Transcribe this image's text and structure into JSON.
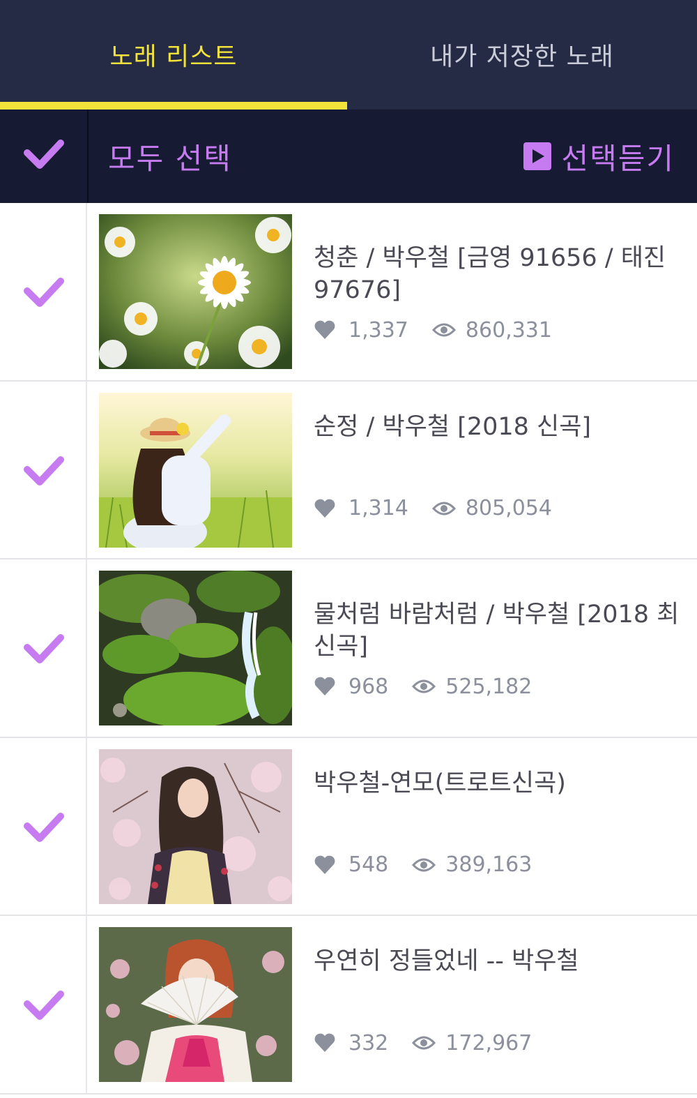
{
  "tabs": [
    {
      "label": "노래 리스트",
      "active": true
    },
    {
      "label": "내가 저장한 노래",
      "active": false
    }
  ],
  "select_bar": {
    "select_all_label": "모두 선택",
    "play_selected_label": "선택듣기"
  },
  "colors": {
    "accent_purple": "#c77bf0",
    "tab_active_yellow": "#f2e23a",
    "header_bg": "#252b45",
    "select_bar_bg": "#161a33"
  },
  "songs": [
    {
      "title": "청춘 / 박우철 [금영 91656 / 태진 97676]",
      "likes": "1,337",
      "views": "860,331",
      "thumbnail": "daisy-flowers",
      "checked": true
    },
    {
      "title": "순정 / 박우철 [2018 신곡]",
      "likes": "1,314",
      "views": "805,054",
      "thumbnail": "woman-in-meadow",
      "checked": true
    },
    {
      "title": "물처럼 바람처럼  / 박우철 [2018 최신곡]",
      "likes": "968",
      "views": "525,182",
      "thumbnail": "mossy-waterfall",
      "checked": true
    },
    {
      "title": "박우철-연모(트로트신곡)",
      "likes": "548",
      "views": "389,163",
      "thumbnail": "woman-blossoms",
      "checked": true
    },
    {
      "title": "우연히 정들었네 -- 박우철",
      "likes": "332",
      "views": "172,967",
      "thumbnail": "woman-hanbok-fan",
      "checked": true
    }
  ]
}
